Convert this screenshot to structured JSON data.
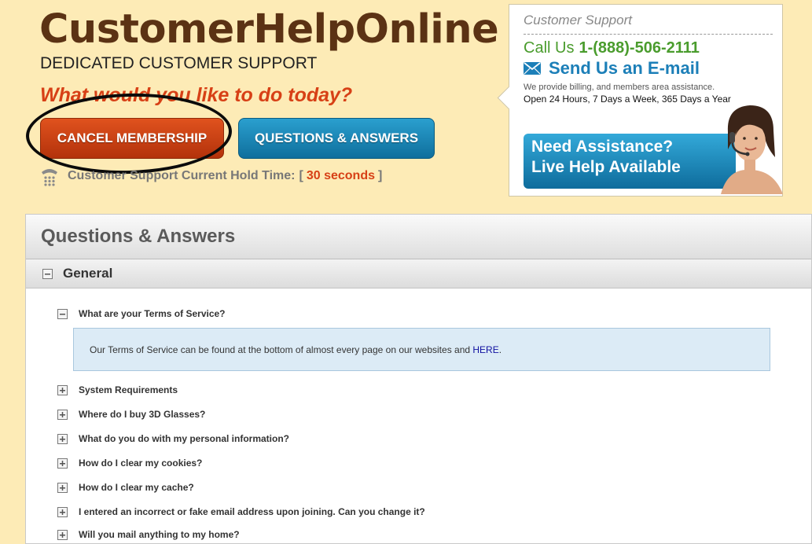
{
  "header": {
    "logo": "CustomerHelpOnline",
    "tagline": "DEDICATED CUSTOMER SUPPORT",
    "question": "What would you like to do today?"
  },
  "buttons": {
    "cancel": "CANCEL MEMBERSHIP",
    "qa": "QUESTIONS & ANSWERS"
  },
  "hold_time": {
    "label": "Customer Support Current Hold Time:",
    "open_bracket": "[",
    "value": "30 seconds",
    "close_bracket": "]"
  },
  "support": {
    "title": "Customer Support",
    "call_label": "Call Us",
    "phone": "1-(888)-506-2111",
    "email_label": "Send Us an E-mail",
    "billing_text": "We provide billing, and members area assistance.",
    "hours_text": "Open 24 Hours, 7 Days a Week, 365 Days a Year",
    "banner_line1": "Need Assistance?",
    "banner_line2": "Live Help Available"
  },
  "qa": {
    "title": "Questions & Answers",
    "category": "General",
    "items": [
      {
        "question": "What are your Terms of Service?",
        "expanded": true
      },
      {
        "question": "System Requirements",
        "expanded": false
      },
      {
        "question": "Where do I buy 3D Glasses?",
        "expanded": false
      },
      {
        "question": "What do you do with my personal information?",
        "expanded": false
      },
      {
        "question": "How do I clear my cookies?",
        "expanded": false
      },
      {
        "question": "How do I clear my cache?",
        "expanded": false
      },
      {
        "question": "I entered an incorrect or fake email address upon joining. Can you change it?",
        "expanded": false
      },
      {
        "question": "Will you mail anything to my home?",
        "expanded": false
      }
    ],
    "answer": {
      "text": "Our Terms of Service can be found at the bottom of almost every page on our websites and",
      "link": "HERE",
      "end": "."
    }
  },
  "colors": {
    "page_bg": "#fdebb6",
    "logo": "#5b3214",
    "accent_red": "#d74016",
    "accent_blue": "#1c7fb8",
    "accent_green": "#4a9c2d"
  }
}
